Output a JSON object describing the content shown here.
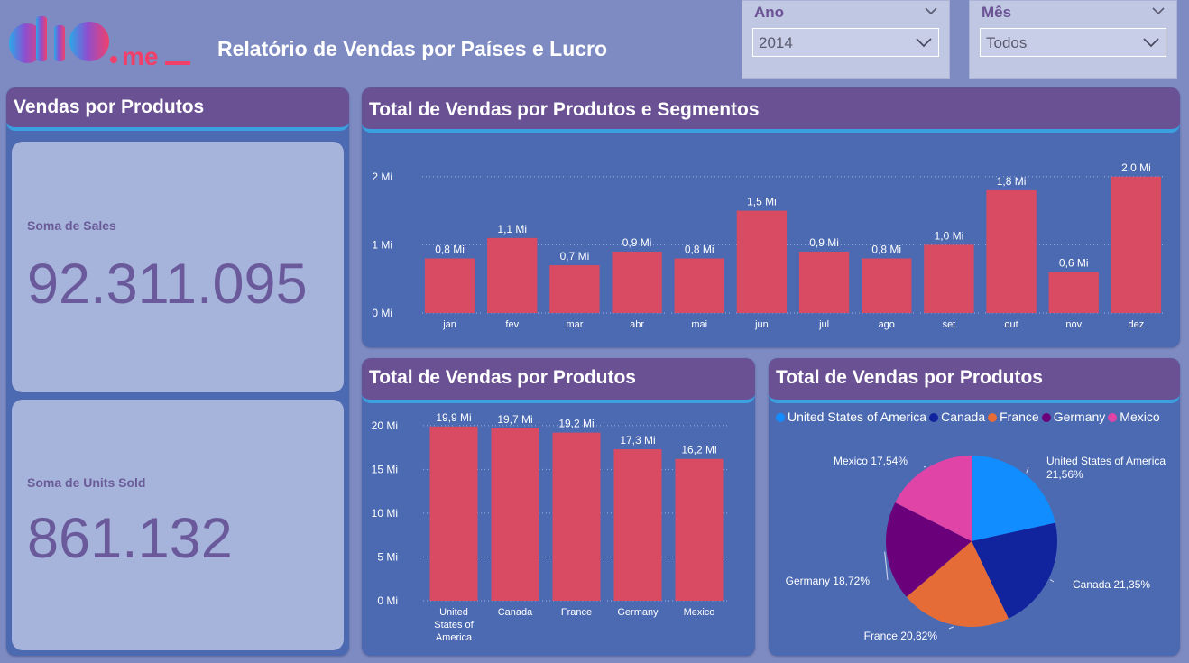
{
  "header": {
    "logo_text": "dio.me_",
    "title": "Relatório de Vendas por Países e Lucro"
  },
  "slicers": {
    "ano": {
      "label": "Ano",
      "value": "2014"
    },
    "mes": {
      "label": "Mês",
      "value": "Todos"
    }
  },
  "kpi_panel": {
    "title": "Vendas por Produtos",
    "sales": {
      "label": "Soma de Sales",
      "value": "92.311.095"
    },
    "units": {
      "label": "Soma de Units Sold",
      "value": "861.132"
    }
  },
  "monthly_chart": {
    "title": "Total de Vendas por Produtos e Segmentos"
  },
  "country_chart": {
    "title": "Total de Vendas por Produtos"
  },
  "pie_chart": {
    "title": "Total de Vendas por Produtos"
  },
  "colors": {
    "bar": "#d94b63",
    "panel": "#4b6ab2",
    "panel_head": "#6a5194",
    "accent_line": "#3aa0e0",
    "kpi_card": "#a6b3db"
  },
  "chart_data": [
    {
      "type": "bar",
      "categories": [
        "jan",
        "fev",
        "mar",
        "abr",
        "mai",
        "jun",
        "jul",
        "ago",
        "set",
        "out",
        "nov",
        "dez"
      ],
      "values": [
        0.8,
        1.1,
        0.7,
        0.9,
        0.8,
        1.5,
        0.9,
        0.8,
        1.0,
        1.8,
        0.6,
        2.0
      ],
      "data_labels": [
        "0,8 Mi",
        "1,1 Mi",
        "0,7 Mi",
        "0,9 Mi",
        "0,8 Mi",
        "1,5 Mi",
        "0,9 Mi",
        "0,8 Mi",
        "1,0 Mi",
        "1,8 Mi",
        "0,6 Mi",
        "2,0 Mi"
      ],
      "yticks": [
        0,
        1,
        2
      ],
      "ytick_labels": [
        "0 Mi",
        "1 Mi",
        "2 Mi"
      ],
      "ylim": [
        0,
        2.05
      ],
      "grid": true
    },
    {
      "type": "bar",
      "categories": [
        "United States of America",
        "Canada",
        "France",
        "Germany",
        "Mexico"
      ],
      "category_label_lines": [
        [
          "United",
          "States of",
          "America"
        ],
        [
          "Canada"
        ],
        [
          "France"
        ],
        [
          "Germany"
        ],
        [
          "Mexico"
        ]
      ],
      "values": [
        19.9,
        19.7,
        19.2,
        17.3,
        16.2
      ],
      "data_labels": [
        "19,9 Mi",
        "19,7 Mi",
        "19,2 Mi",
        "17,3 Mi",
        "16,2 Mi"
      ],
      "yticks": [
        0,
        5,
        10,
        15,
        20
      ],
      "ytick_labels": [
        "0 Mi",
        "5 Mi",
        "10 Mi",
        "15 Mi",
        "20 Mi"
      ],
      "ylim": [
        0,
        20.5
      ],
      "grid": true
    },
    {
      "type": "pie",
      "legend_placement": "top",
      "slices": [
        {
          "name": "United States of America",
          "value": 21.56,
          "label": "21,56%",
          "color": "#118dff"
        },
        {
          "name": "Canada",
          "value": 21.35,
          "label": "21,35%",
          "color": "#12239e"
        },
        {
          "name": "France",
          "value": 20.82,
          "label": "20,82%",
          "color": "#e66c37"
        },
        {
          "name": "Germany",
          "value": 18.72,
          "label": "18,72%",
          "color": "#6b007b"
        },
        {
          "name": "Mexico",
          "value": 17.54,
          "label": "17,54%",
          "color": "#e044a7"
        }
      ]
    }
  ]
}
